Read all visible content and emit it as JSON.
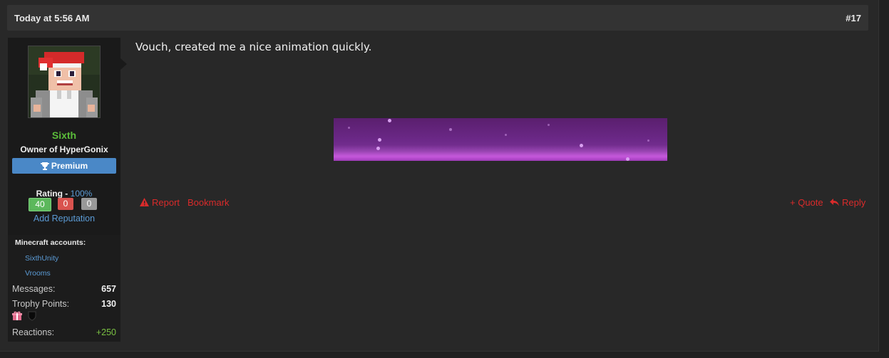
{
  "post": {
    "date": "Today at 5:56 AM",
    "number": "#17",
    "message": "Vouch, created me a nice animation quickly."
  },
  "user": {
    "name": "Sixth",
    "title": "Owner of HyperGonix",
    "badge": "Premium",
    "rating_label": "Rating - ",
    "rating_value": "100%",
    "rep_positive": "40",
    "rep_negative": "0",
    "rep_neutral": "0",
    "add_reputation": "Add Reputation",
    "minecraft_label": "Minecraft accounts:",
    "minecraft_accounts": [
      "SixthUnity",
      "Vrooms"
    ],
    "stats": {
      "messages_label": "Messages:",
      "messages_value": "657",
      "trophy_label": "Trophy Points:",
      "trophy_value": "130",
      "reactions_label": "Reactions:",
      "reactions_value": "+250"
    }
  },
  "actions": {
    "report": "Report",
    "bookmark": "Bookmark",
    "quote": "+ Quote",
    "reply": "Reply"
  },
  "colors": {
    "username": "#5bbd3a",
    "link": "#5b9bd5",
    "action": "#d92b2b",
    "premium": "#4a88c7"
  },
  "icons": {
    "report": "warning-icon",
    "reply": "reply-arrow-icon",
    "badge": "trophy-icon",
    "trophies": [
      "gift-icon",
      "shield-icon"
    ]
  }
}
